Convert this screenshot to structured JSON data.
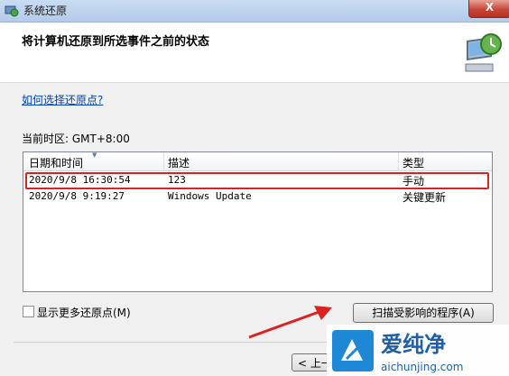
{
  "window": {
    "title": "系统还原",
    "close_symbol": "X"
  },
  "header": {
    "title": "将计算机还原到所选事件之前的状态"
  },
  "link": {
    "text": "如何选择还原点?"
  },
  "timezone": {
    "text": "当前时区: GMT+8:00"
  },
  "table": {
    "columns": [
      "日期和时间",
      "描述",
      "类型"
    ],
    "rows": [
      {
        "datetime": "2020/9/8 16:30:54",
        "description": "123",
        "type": "手动",
        "selected": true
      },
      {
        "datetime": "2020/9/8 9:19:27",
        "description": "Windows Update",
        "type": "关键更新",
        "selected": false
      }
    ]
  },
  "checkbox": {
    "label": "显示更多还原点(M)",
    "checked": false
  },
  "buttons": {
    "scan": "扫描受影响的程序(A)",
    "back": "< 上一步"
  },
  "watermark": {
    "brand": "爱纯净",
    "url": "aichunjing.com"
  },
  "colors": {
    "highlight_box": "#e02020",
    "arrow": "#e02020",
    "link": "#0645ad"
  }
}
